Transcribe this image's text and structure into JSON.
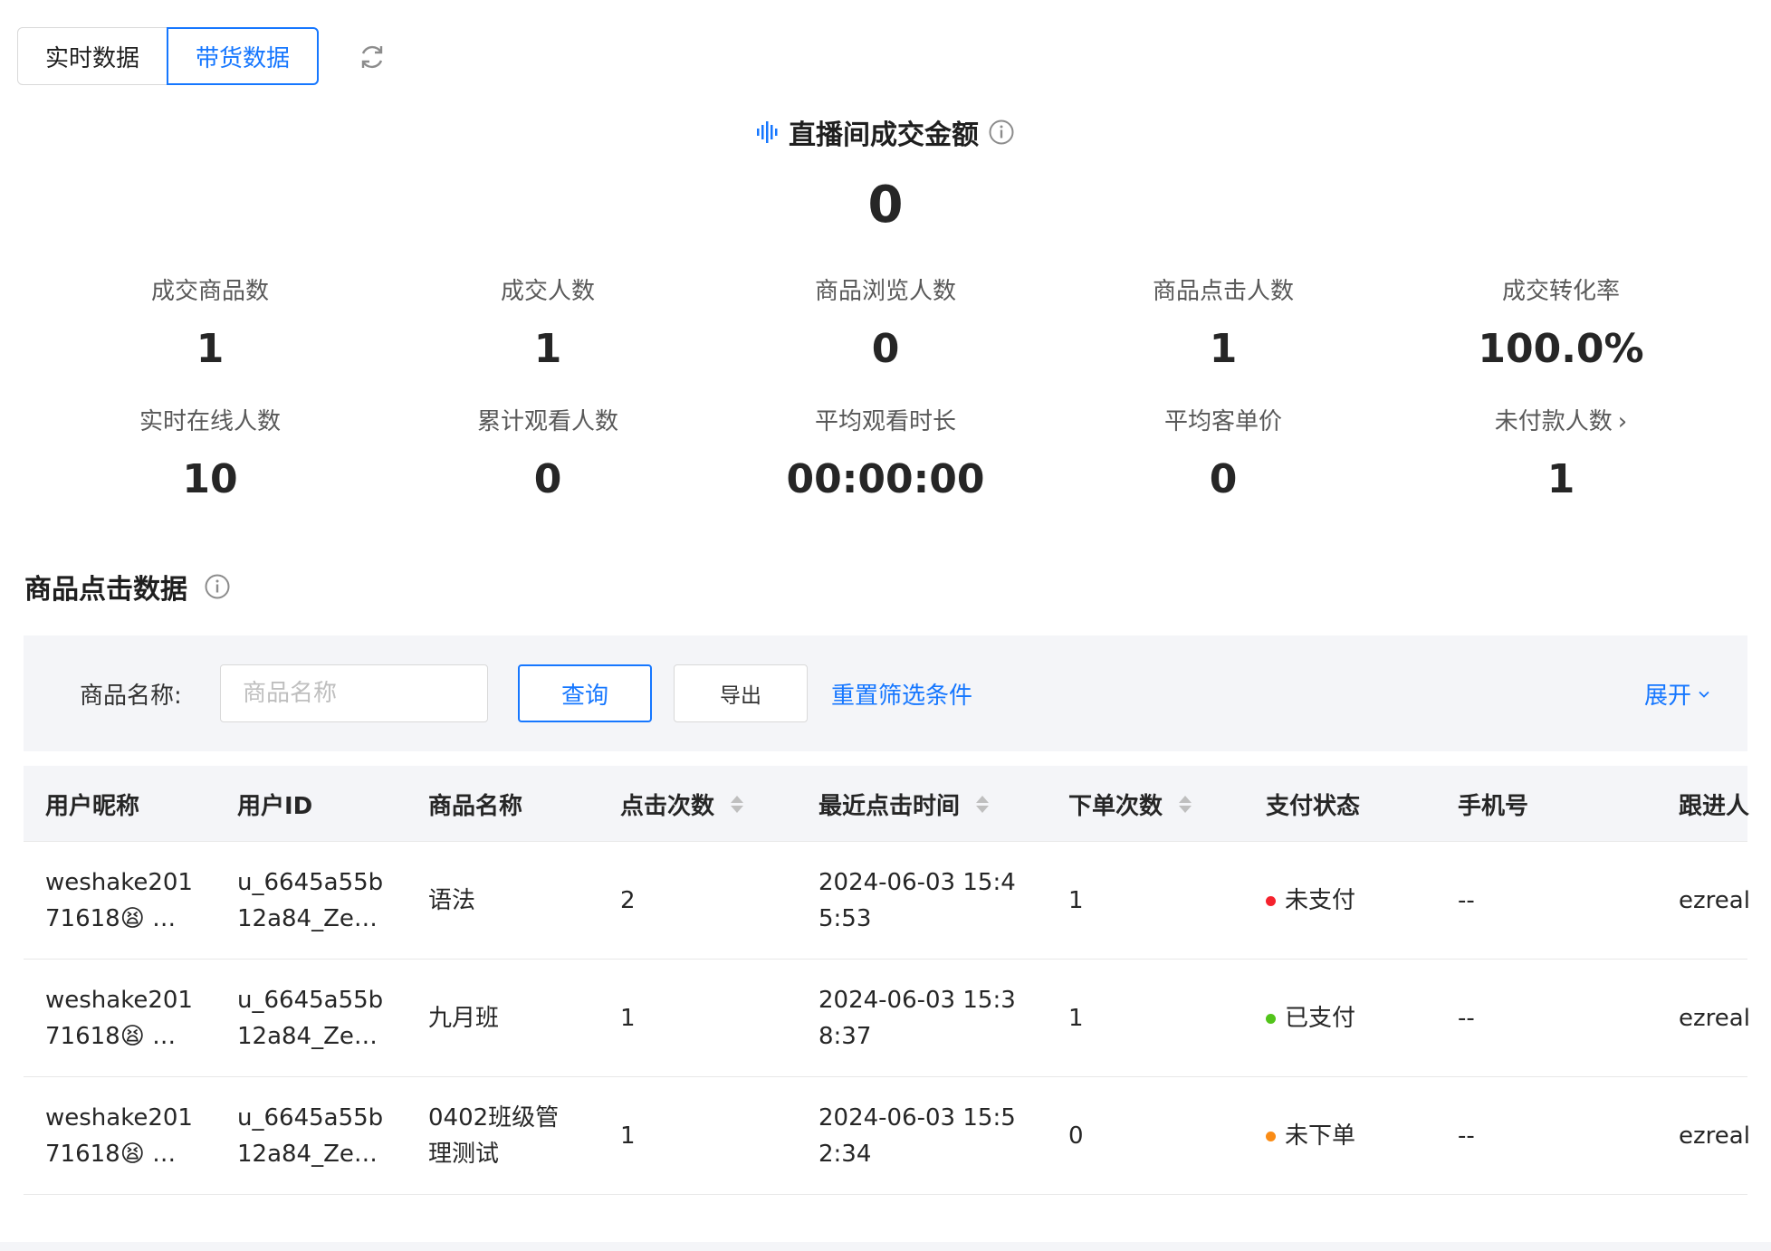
{
  "tabs": [
    {
      "label": "实时数据",
      "active": false
    },
    {
      "label": "带货数据",
      "active": true
    }
  ],
  "headline": {
    "label": "直播间成交金额",
    "value": "0"
  },
  "stats_row1": [
    {
      "label": "成交商品数",
      "value": "1"
    },
    {
      "label": "成交人数",
      "value": "1"
    },
    {
      "label": "商品浏览人数",
      "value": "0"
    },
    {
      "label": "商品点击人数",
      "value": "1"
    },
    {
      "label": "成交转化率",
      "value": "100.0%"
    }
  ],
  "stats_row2": [
    {
      "label": "实时在线人数",
      "value": "10"
    },
    {
      "label": "累计观看人数",
      "value": "0"
    },
    {
      "label": "平均观看时长",
      "value": "00:00:00"
    },
    {
      "label": "平均客单价",
      "value": "0"
    },
    {
      "label": "未付款人数",
      "value": "1"
    }
  ],
  "section": {
    "title": "商品点击数据"
  },
  "filter": {
    "label": "商品名称:",
    "placeholder": "商品名称",
    "query_label": "查询",
    "export_label": "导出",
    "reset_label": "重置筛选条件",
    "expand_label": "展开"
  },
  "table": {
    "columns": [
      "用户昵称",
      "用户ID",
      "商品名称",
      "点击次数",
      "最近点击时间",
      "下单次数",
      "支付状态",
      "手机号",
      "跟进人"
    ],
    "rows": [
      {
        "nickname": "weshake201\n71618😫 …",
        "user_id": "u_6645a55b\n12a84_Ze…",
        "product": "语法",
        "clicks": "2",
        "last_click": "2024-06-03 15:4\n5:53",
        "orders": "1",
        "pay_status": "未支付",
        "pay_color": "#f5222d",
        "phone": "--",
        "follower": "ezreal"
      },
      {
        "nickname": "weshake201\n71618😫 …",
        "user_id": "u_6645a55b\n12a84_Ze…",
        "product": "九月班",
        "clicks": "1",
        "last_click": "2024-06-03 15:3\n8:37",
        "orders": "1",
        "pay_status": "已支付",
        "pay_color": "#52c41a",
        "phone": "--",
        "follower": "ezreal"
      },
      {
        "nickname": "weshake201\n71618😫 …",
        "user_id": "u_6645a55b\n12a84_Ze…",
        "product": "0402班级管\n理测试",
        "clicks": "1",
        "last_click": "2024-06-03 15:5\n2:34",
        "orders": "0",
        "pay_status": "未下单",
        "pay_color": "#fa8c16",
        "phone": "--",
        "follower": "ezreal"
      }
    ]
  }
}
